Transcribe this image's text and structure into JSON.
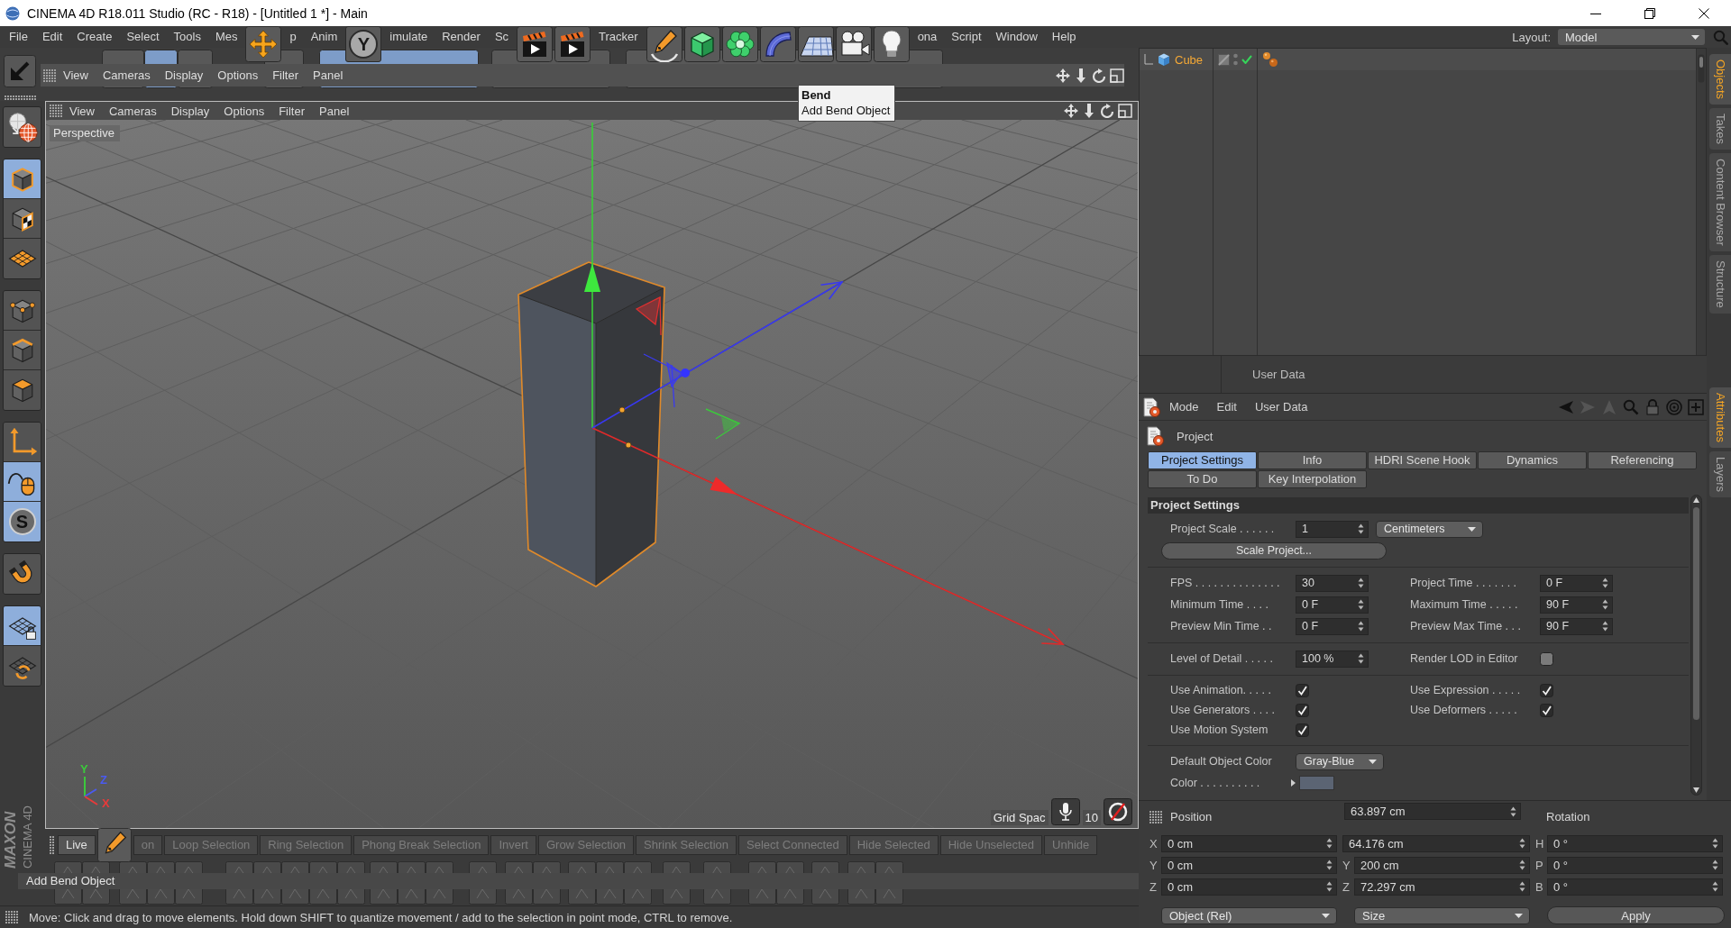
{
  "window": {
    "title": "CINEMA 4D R18.011 Studio (RC - R18) - [Untitled 1 *] - Main"
  },
  "menu_bar": {
    "items": [
      {
        "kind": "menu",
        "label": "File"
      },
      {
        "kind": "menu",
        "label": "Edit"
      },
      {
        "kind": "menu",
        "label": "Create"
      },
      {
        "kind": "menu",
        "label": "Select"
      },
      {
        "kind": "menu",
        "label": "Tools"
      },
      {
        "kind": "menu",
        "label": "Mes"
      },
      {
        "kind": "tool"
      },
      {
        "kind": "menu",
        "label": "p"
      },
      {
        "kind": "menu",
        "label": "Anim"
      },
      {
        "kind": "letter",
        "label": "Y"
      },
      {
        "kind": "menu",
        "label": "imulate"
      },
      {
        "kind": "menu",
        "label": "Render"
      },
      {
        "kind": "menu",
        "label": "Sc"
      },
      {
        "kind": "tool"
      },
      {
        "kind": "tool"
      },
      {
        "kind": "menu",
        "label": "Tracker"
      },
      {
        "kind": "tool"
      },
      {
        "kind": "tool"
      },
      {
        "kind": "tool"
      },
      {
        "kind": "tool"
      },
      {
        "kind": "tool"
      },
      {
        "kind": "tool"
      },
      {
        "kind": "tool"
      },
      {
        "kind": "menu",
        "label": "ona"
      },
      {
        "kind": "menu",
        "label": "Script"
      },
      {
        "kind": "menu",
        "label": "Window"
      },
      {
        "kind": "menu",
        "label": "Help"
      }
    ],
    "layout": {
      "label": "Layout:",
      "value": "Model"
    }
  },
  "toolbar": {
    "menu": [
      "View",
      "Cameras",
      "Display",
      "Options",
      "Filter",
      "Panel"
    ],
    "tooltip": {
      "title": "Bend",
      "text": "Add Bend Object"
    }
  },
  "left_toolbar": {
    "groups": [
      [
        {
          "kind": "tool",
          "selected": false
        }
      ],
      [
        {
          "kind": "tool",
          "selected": true
        },
        {
          "kind": "tool",
          "selected": false
        },
        {
          "kind": "tool",
          "selected": false
        }
      ],
      [
        {
          "kind": "tool",
          "selected": false
        },
        {
          "kind": "tool",
          "selected": false
        },
        {
          "kind": "tool",
          "selected": false
        }
      ],
      [
        {
          "kind": "tool",
          "selected": false
        },
        {
          "kind": "tool",
          "selected": true
        },
        {
          "kind": "letter",
          "label": "S",
          "selected": true
        }
      ],
      [
        {
          "kind": "tool",
          "selected": false
        }
      ],
      [
        {
          "kind": "tool",
          "selected": true
        },
        {
          "kind": "tool",
          "selected": false
        }
      ]
    ]
  },
  "logo": {
    "brand": "MAXON",
    "product": "CINEMA 4D"
  },
  "viewport": {
    "menu": [
      "View",
      "Cameras",
      "Display",
      "Options",
      "Filter",
      "Panel"
    ],
    "camera": "Perspective",
    "world_axes": [
      {
        "label": "Y",
        "color": "#3cc83c"
      },
      {
        "label": "Z",
        "color": "#4a5af0"
      },
      {
        "label": "X",
        "color": "#e83a3a"
      }
    ],
    "grid_info": [
      "Grid Spac",
      "10"
    ]
  },
  "selection_bar": {
    "items": [
      {
        "kind": "button",
        "label": "Live",
        "disabled": false
      },
      {
        "kind": "tool"
      },
      {
        "kind": "button",
        "label": "on",
        "disabled": true
      },
      {
        "kind": "button",
        "label": "Loop Selection",
        "disabled": true
      },
      {
        "kind": "button",
        "label": "Ring Selection",
        "disabled": true
      },
      {
        "kind": "button",
        "label": "Phong Break Selection",
        "disabled": true
      },
      {
        "kind": "button",
        "label": "Invert",
        "disabled": true
      },
      {
        "kind": "button",
        "label": "Grow Selection",
        "disabled": true
      },
      {
        "kind": "button",
        "label": "Shrink Selection",
        "disabled": true
      },
      {
        "kind": "button",
        "label": "Select Connected",
        "disabled": true
      },
      {
        "kind": "button",
        "label": "Hide Selected",
        "disabled": true
      },
      {
        "kind": "button",
        "label": "Hide Unselected",
        "disabled": true
      },
      {
        "kind": "button",
        "label": "Unhide",
        "disabled": true
      }
    ]
  },
  "hint": "Add Bend Object",
  "status_bar": {
    "text": "Move: Click and drag to move elements. Hold down SHIFT to quantize movement / add to the selection in point mode, CTRL to remove."
  },
  "object_manager": {
    "objects": [
      {
        "name": "Cube",
        "selected": true,
        "enabled": true
      }
    ],
    "footer": "User Data"
  },
  "side_tabs": {
    "top": [
      {
        "label": "Objects",
        "selected": true
      },
      {
        "label": "Takes",
        "selected": false
      },
      {
        "label": "Content Browser",
        "selected": false
      },
      {
        "label": "Structure",
        "selected": false
      }
    ],
    "bottom": [
      {
        "label": "Attributes",
        "selected": true
      },
      {
        "label": "Layers",
        "selected": false
      }
    ]
  },
  "attributes": {
    "menu": [
      "Mode",
      "Edit",
      "User Data"
    ],
    "title": "Project",
    "tabs": [
      [
        {
          "label": "Project Settings",
          "selected": true
        },
        {
          "label": "Info",
          "selected": false
        },
        {
          "label": "HDRI Scene Hook",
          "selected": false
        },
        {
          "label": "Dynamics",
          "selected": false
        },
        {
          "label": "Referencing",
          "selected": false
        }
      ],
      [
        {
          "label": "To Do",
          "selected": false
        },
        {
          "label": "Key Interpolation",
          "selected": false
        }
      ]
    ],
    "section": "Project Settings",
    "groups": [
      [
        [
          {
            "kind": "number",
            "label": "Project Scale . . . . . .",
            "value": "1",
            "unit": "Centimeters"
          }
        ],
        [
          {
            "kind": "button",
            "label": "Scale Project..."
          }
        ]
      ],
      [
        [
          {
            "kind": "number",
            "label": "FPS . . . . . . . . . . . . . .",
            "value": "30"
          },
          {
            "kind": "number",
            "label": "Project Time . . . . . . .",
            "value": "0 F"
          }
        ],
        [
          {
            "kind": "number",
            "label": "Minimum Time . . . .",
            "value": "0 F"
          },
          {
            "kind": "number",
            "label": "Maximum Time . . . . .",
            "value": "90 F"
          }
        ],
        [
          {
            "kind": "number",
            "label": "Preview Min Time . .",
            "value": "0 F"
          },
          {
            "kind": "number",
            "label": "Preview Max Time . . .",
            "value": "90 F"
          }
        ]
      ],
      [
        [
          {
            "kind": "number",
            "label": "Level of Detail . . . . .",
            "value": "100 %"
          },
          {
            "kind": "check",
            "label": "Render LOD in Editor",
            "checked": false
          }
        ]
      ],
      [
        [
          {
            "kind": "check",
            "label": "Use Animation. . . . .",
            "checked": true
          },
          {
            "kind": "check",
            "label": "Use Expression . . . . .",
            "checked": true
          }
        ],
        [
          {
            "kind": "check",
            "label": "Use Generators . . . .",
            "checked": true
          },
          {
            "kind": "check",
            "label": "Use Deformers . . . . .",
            "checked": true
          }
        ],
        [
          {
            "kind": "check",
            "label": "Use Motion System",
            "checked": true
          }
        ]
      ],
      [
        [
          {
            "kind": "dropdown",
            "label": "Default Object Color",
            "value": "Gray-Blue"
          }
        ],
        [
          {
            "kind": "color",
            "label": "Color . . . . . . . . . .",
            "color": "#5b6473"
          }
        ]
      ]
    ]
  },
  "coordinates": {
    "position_title": "Position",
    "floating_value": "63.897 cm",
    "rotation_title": "Rotation",
    "columns": [
      [
        {
          "axis": "X",
          "value": "0 cm"
        },
        {
          "axis": "Y",
          "value": "0 cm"
        },
        {
          "axis": "Z",
          "value": "0 cm"
        }
      ],
      [
        {
          "value": "64.176 cm"
        },
        {
          "axis": "Y",
          "value": "200 cm"
        },
        {
          "axis": "Z",
          "value": "72.297 cm"
        }
      ],
      [
        {
          "axis": "H",
          "value": "0 °"
        },
        {
          "axis": "P",
          "value": "0 °"
        },
        {
          "axis": "B",
          "value": "0 °"
        }
      ]
    ],
    "modes": [
      "Object (Rel)",
      "Size"
    ],
    "apply": "Apply"
  }
}
